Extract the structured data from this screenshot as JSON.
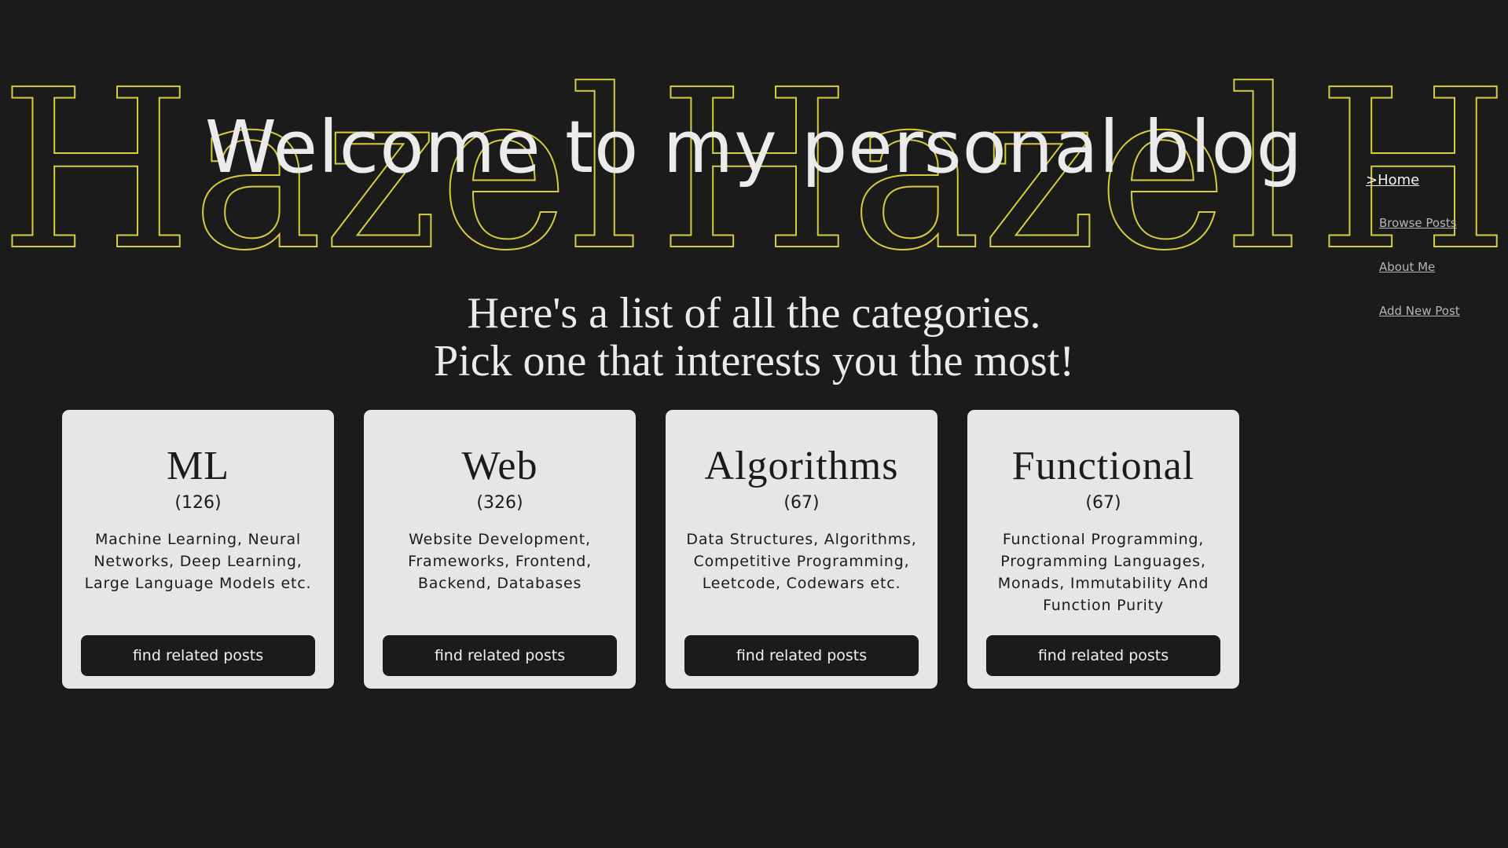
{
  "background": {
    "watermark_text": "Hazel",
    "watermark_color": "#d8cc3c",
    "background_color": "#1b1b1b"
  },
  "hero": {
    "title": "Welcome to my personal blog"
  },
  "nav": {
    "home": ">Home",
    "items": [
      {
        "label": "Browse Posts"
      },
      {
        "label": "About Me"
      },
      {
        "label": "Add New Post"
      }
    ]
  },
  "intro": {
    "line1": "Here's a list of all the categories.",
    "line2": "Pick one that interests you the most!"
  },
  "categories": [
    {
      "name": "ML",
      "count": "(126)",
      "description": "Machine Learning, Neural Networks, Deep Learning, Large Language Models etc.",
      "button": "find related posts"
    },
    {
      "name": "Web",
      "count": "(326)",
      "description": "Website Development, Frameworks, Frontend, Backend, Databases",
      "button": "find related posts"
    },
    {
      "name": "Algorithms",
      "count": "(67)",
      "description": "Data Structures, Algorithms, Competitive Programming, Leetcode, Codewars etc.",
      "button": "find related posts"
    },
    {
      "name": "Functional",
      "count": "(67)",
      "description": "Functional Programming, Programming Languages, Monads, Immutability And Function Purity",
      "button": "find related posts"
    }
  ]
}
